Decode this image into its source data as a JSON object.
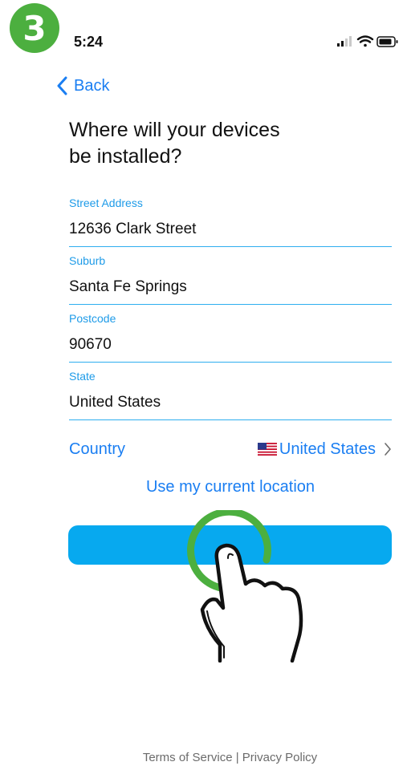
{
  "step_badge": "3",
  "status_bar": {
    "time": "5:24"
  },
  "nav": {
    "back_label": "Back"
  },
  "title": "Where will your devices be installed?",
  "fields": [
    {
      "label": "Street Address",
      "value": "12636 Clark Street"
    },
    {
      "label": "Suburb",
      "value": "Santa Fe Springs"
    },
    {
      "label": "Postcode",
      "value": "90670"
    },
    {
      "label": "State",
      "value": "United States"
    }
  ],
  "country": {
    "label": "Country",
    "value": "United States"
  },
  "use_location_label": "Use my current location",
  "footer": {
    "terms": "Terms of Service",
    "separator": "|",
    "privacy": "Privacy Policy"
  },
  "colors": {
    "accent": "#1a7ef2",
    "button": "#07a9ef",
    "field_line": "#2eaef0",
    "badge": "#4caf3f"
  }
}
